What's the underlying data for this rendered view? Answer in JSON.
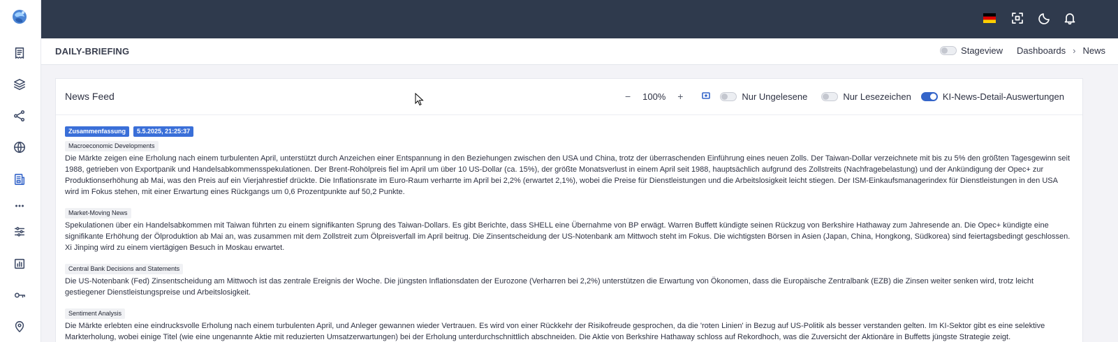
{
  "sidebar": {
    "items": [
      {
        "name": "sidebar-item-briefing",
        "icon": "receipt-icon"
      },
      {
        "name": "sidebar-item-layers",
        "icon": "layers-icon"
      },
      {
        "name": "sidebar-item-graph",
        "icon": "nodes-icon"
      },
      {
        "name": "sidebar-item-globe",
        "icon": "globe-icon"
      },
      {
        "name": "sidebar-item-news",
        "icon": "newspaper-icon",
        "active": true
      },
      {
        "name": "sidebar-item-more",
        "icon": "more-dots-icon"
      },
      {
        "name": "sidebar-item-filters",
        "icon": "sliders-icon"
      },
      {
        "name": "sidebar-item-charts",
        "icon": "bar-chart-icon"
      },
      {
        "name": "sidebar-item-keys",
        "icon": "key-icon"
      },
      {
        "name": "sidebar-item-location",
        "icon": "map-pin-icon"
      }
    ]
  },
  "topbar": {
    "icons": [
      "german-flag-icon",
      "fullscreen-icon",
      "moon-icon",
      "bell-icon"
    ]
  },
  "page": {
    "title": "DAILY-BRIEFING",
    "stageview_label": "Stageview",
    "breadcrumb": [
      "Dashboards",
      "News"
    ]
  },
  "card": {
    "title": "News Feed",
    "zoom_minus": "−",
    "zoom_value": "100%",
    "zoom_plus": "+",
    "toggle_unread_label": "Nur Ungelesene",
    "toggle_bookmarks_label": "Nur Lesezeichen",
    "toggle_ai_label": "KI-News-Detail-Auswertungen",
    "toggle_unread_on": false,
    "toggle_bookmarks_on": false,
    "toggle_ai_on": true
  },
  "entry": {
    "badge_type": "Zusammenfassung",
    "badge_date": "5.5.2025, 21:25:37",
    "sections": [
      {
        "tag": "Macroeconomic Developments",
        "text": "Die Märkte zeigen eine Erholung nach einem turbulenten April, unterstützt durch Anzeichen einer Entspannung in den Beziehungen zwischen den USA und China, trotz der überraschenden Einführung eines neuen Zolls. Der Taiwan-Dollar verzeichnete mit bis zu 5% den größten Tagesgewinn seit 1988, getrieben von Exportpanik und Handelsabkommensspekulationen. Der Brent-Rohölpreis fiel im April um über 10 US-Dollar (ca. 15%), der größte Monatsverlust in einem April seit 1988, hauptsächlich aufgrund des Zollstreits (Nachfragebelastung) und der Ankündigung der Opec+ zur Produktionserhöhung ab Mai, was den Preis auf ein Vierjahrestief drückte. Die Inflationsrate im Euro-Raum verharrte im April bei 2,2% (erwartet 2,1%), wobei die Preise für Dienstleistungen und die Arbeitslosigkeit leicht stiegen. Der ISM-Einkaufsmanagerindex für Dienstleistungen in den USA wird im Fokus stehen, mit einer Erwartung eines Rückgangs um 0,6 Prozentpunkte auf 50,2 Punkte."
      },
      {
        "tag": "Market-Moving News",
        "text": "Spekulationen über ein Handelsabkommen mit Taiwan führten zu einem signifikanten Sprung des Taiwan-Dollars. Es gibt Berichte, dass SHELL eine Übernahme von BP erwägt. Warren Buffett kündigte seinen Rückzug von Berkshire Hathaway zum Jahresende an. Die Opec+ kündigte eine signifikante Erhöhung der Ölproduktion ab Mai an, was zusammen mit dem Zollstreit zum Ölpreisverfall im April beitrug. Die Zinsentscheidung der US-Notenbank am Mittwoch steht im Fokus. Die wichtigsten Börsen in Asien (Japan, China, Hongkong, Südkorea) sind feiertagsbedingt geschlossen. Xi Jinping wird zu einem viertägigen Besuch in Moskau erwartet."
      },
      {
        "tag": "Central Bank Decisions and Statements",
        "text": "Die US-Notenbank (Fed) Zinsentscheidung am Mittwoch ist das zentrale Ereignis der Woche. Die jüngsten Inflationsdaten der Eurozone (Verharren bei 2,2%) unterstützen die Erwartung von Ökonomen, dass die Europäische Zentralbank (EZB) die Zinsen weiter senken wird, trotz leicht gestiegener Dienstleistungspreise und Arbeitslosigkeit."
      },
      {
        "tag": "Sentiment Analysis",
        "text": "Die Märkte erlebten eine eindrucksvolle Erholung nach einem turbulenten April, und Anleger gewannen wieder Vertrauen. Es wird von einer Rückkehr der Risikofreude gesprochen, da die 'roten Linien' in Bezug auf US-Politik als besser verstanden gelten. Im KI-Sektor gibt es eine selektive Markterholung, wobei einige Titel (wie eine ungenannte Aktie mit reduzierten Umsatzerwartungen) bei der Erholung unterdurchschnittlich abschneiden. Die Aktie von Berkshire Hathaway schloss auf Rekordhoch, was die Zuversicht der Aktionäre in Buffetts jüngste Strategie zeigt."
      }
    ]
  },
  "colors": {
    "topbar": "#2f3a4d",
    "accent": "#3565c9",
    "badge": "#3a6fd8"
  }
}
